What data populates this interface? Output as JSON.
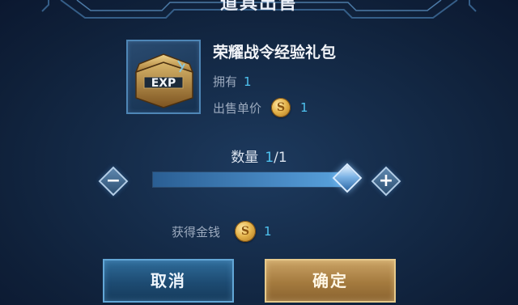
{
  "dialog": {
    "title": "道具出售"
  },
  "item": {
    "name": "荣耀战令经验礼包",
    "icon": "exp-chest-icon",
    "icon_text": "EXP",
    "owned_label": "拥有",
    "owned_value": "1",
    "price_label": "出售单价",
    "price_value": "1"
  },
  "quantity": {
    "label": "数量",
    "current": "1",
    "total": "/1",
    "fill_fraction": 1.0
  },
  "gain": {
    "label": "获得金钱",
    "value": "1"
  },
  "buttons": {
    "cancel": "取消",
    "confirm": "确定"
  },
  "colors": {
    "accent_value": "#4fc3f0",
    "gold": "#e3b24a",
    "confirm_button": "#a47a3e",
    "cancel_button": "#1d4b72"
  }
}
